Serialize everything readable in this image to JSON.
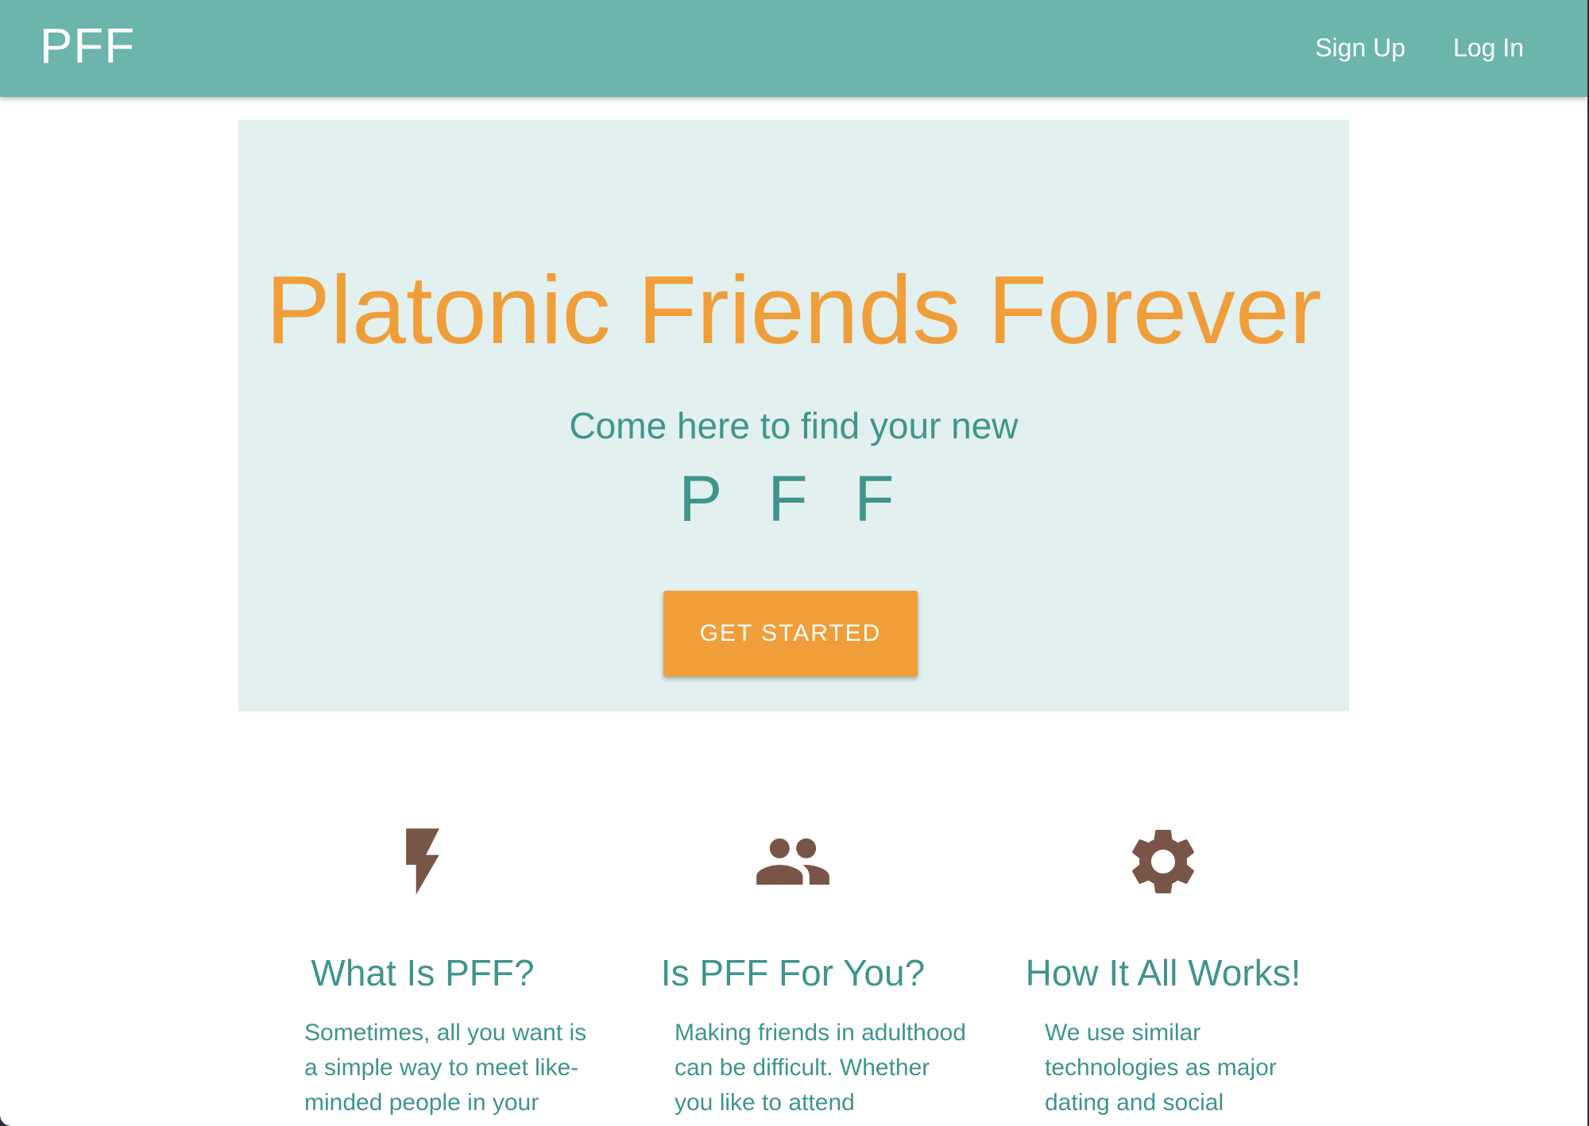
{
  "navbar": {
    "brand": "PFF",
    "links": [
      "Sign Up",
      "Log In"
    ]
  },
  "hero": {
    "title": "Platonic Friends Forever",
    "subtitle": "Come here to find your new",
    "acronym": "P F F",
    "cta_label": "GET STARTED"
  },
  "features": [
    {
      "icon": "flash-icon",
      "title": "What Is PFF?",
      "text": "Sometimes, all you want is a simple way to meet like-minded people in your"
    },
    {
      "icon": "people-icon",
      "title": "Is PFF For You?",
      "text": "Making friends in adulthood can be difficult. Whether you like to attend"
    },
    {
      "icon": "gear-icon",
      "title": "How It All Works!",
      "text": "We use similar technologies as major dating and social"
    }
  ],
  "colors": {
    "navbar": "#6bb5ac",
    "accent": "#f09e3a",
    "text_teal": "#3f958c",
    "hero_bg": "#e2f0ef",
    "icon_brown": "#795548"
  }
}
